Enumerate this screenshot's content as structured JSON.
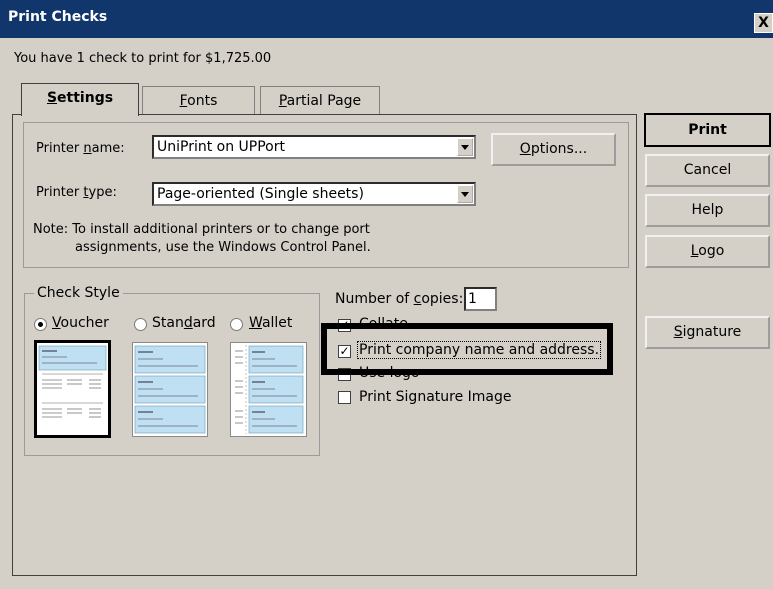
{
  "window": {
    "title": "Print Checks",
    "close_label": "X",
    "summary": "You have 1 check to print for $1,725.00"
  },
  "tabs": [
    {
      "label": "Settings",
      "access_key": "S",
      "rest": "ettings",
      "active": true
    },
    {
      "label": "Fonts",
      "access_key": "F",
      "rest": "onts",
      "active": false
    },
    {
      "label": "Partial Page",
      "access_key": "P",
      "rest": "artial Page",
      "active": false
    }
  ],
  "printer": {
    "name_label_pre": "Printer ",
    "name_label_key": "n",
    "name_label_post": "ame:",
    "name_value": "UniPrint on UPPort",
    "type_label_pre": "Printer ",
    "type_label_key": "t",
    "type_label_post": "ype:",
    "type_value": "Page-oriented (Single sheets)",
    "note_line1": "Note: To install additional printers or to change port",
    "note_line2": "assignments, use the Windows Control Panel.",
    "options_key": "O",
    "options_rest": "ptions..."
  },
  "check_style": {
    "legend": "Check Style",
    "options": [
      {
        "pre": "",
        "key": "V",
        "post": "oucher",
        "selected": true
      },
      {
        "pre": "Stan",
        "key": "d",
        "post": "ard",
        "selected": false
      },
      {
        "pre": "",
        "key": "W",
        "post": "allet",
        "selected": false
      }
    ]
  },
  "copies": {
    "label_pre": "Number of ",
    "label_key": "c",
    "label_post": "opies:",
    "value": "1"
  },
  "options": {
    "collate": {
      "label": "Collate",
      "checked": true
    },
    "print_company": {
      "label": "Print company name and address.",
      "checked": true
    },
    "use_logo": {
      "label": "Use logo",
      "checked": false
    },
    "print_signature": {
      "label": "Print Signature Image",
      "checked": false
    }
  },
  "side_buttons": {
    "print": "Print",
    "cancel": "Cancel",
    "help": "Help",
    "logo_key": "L",
    "logo_rest": "ogo",
    "signature_key": "S",
    "signature_rest": "ignature"
  },
  "colors": {
    "titlebar": "#11366c",
    "face": "#d4d0c8",
    "thumb_blue": "#bfe0f2",
    "highlight": "#000000"
  }
}
